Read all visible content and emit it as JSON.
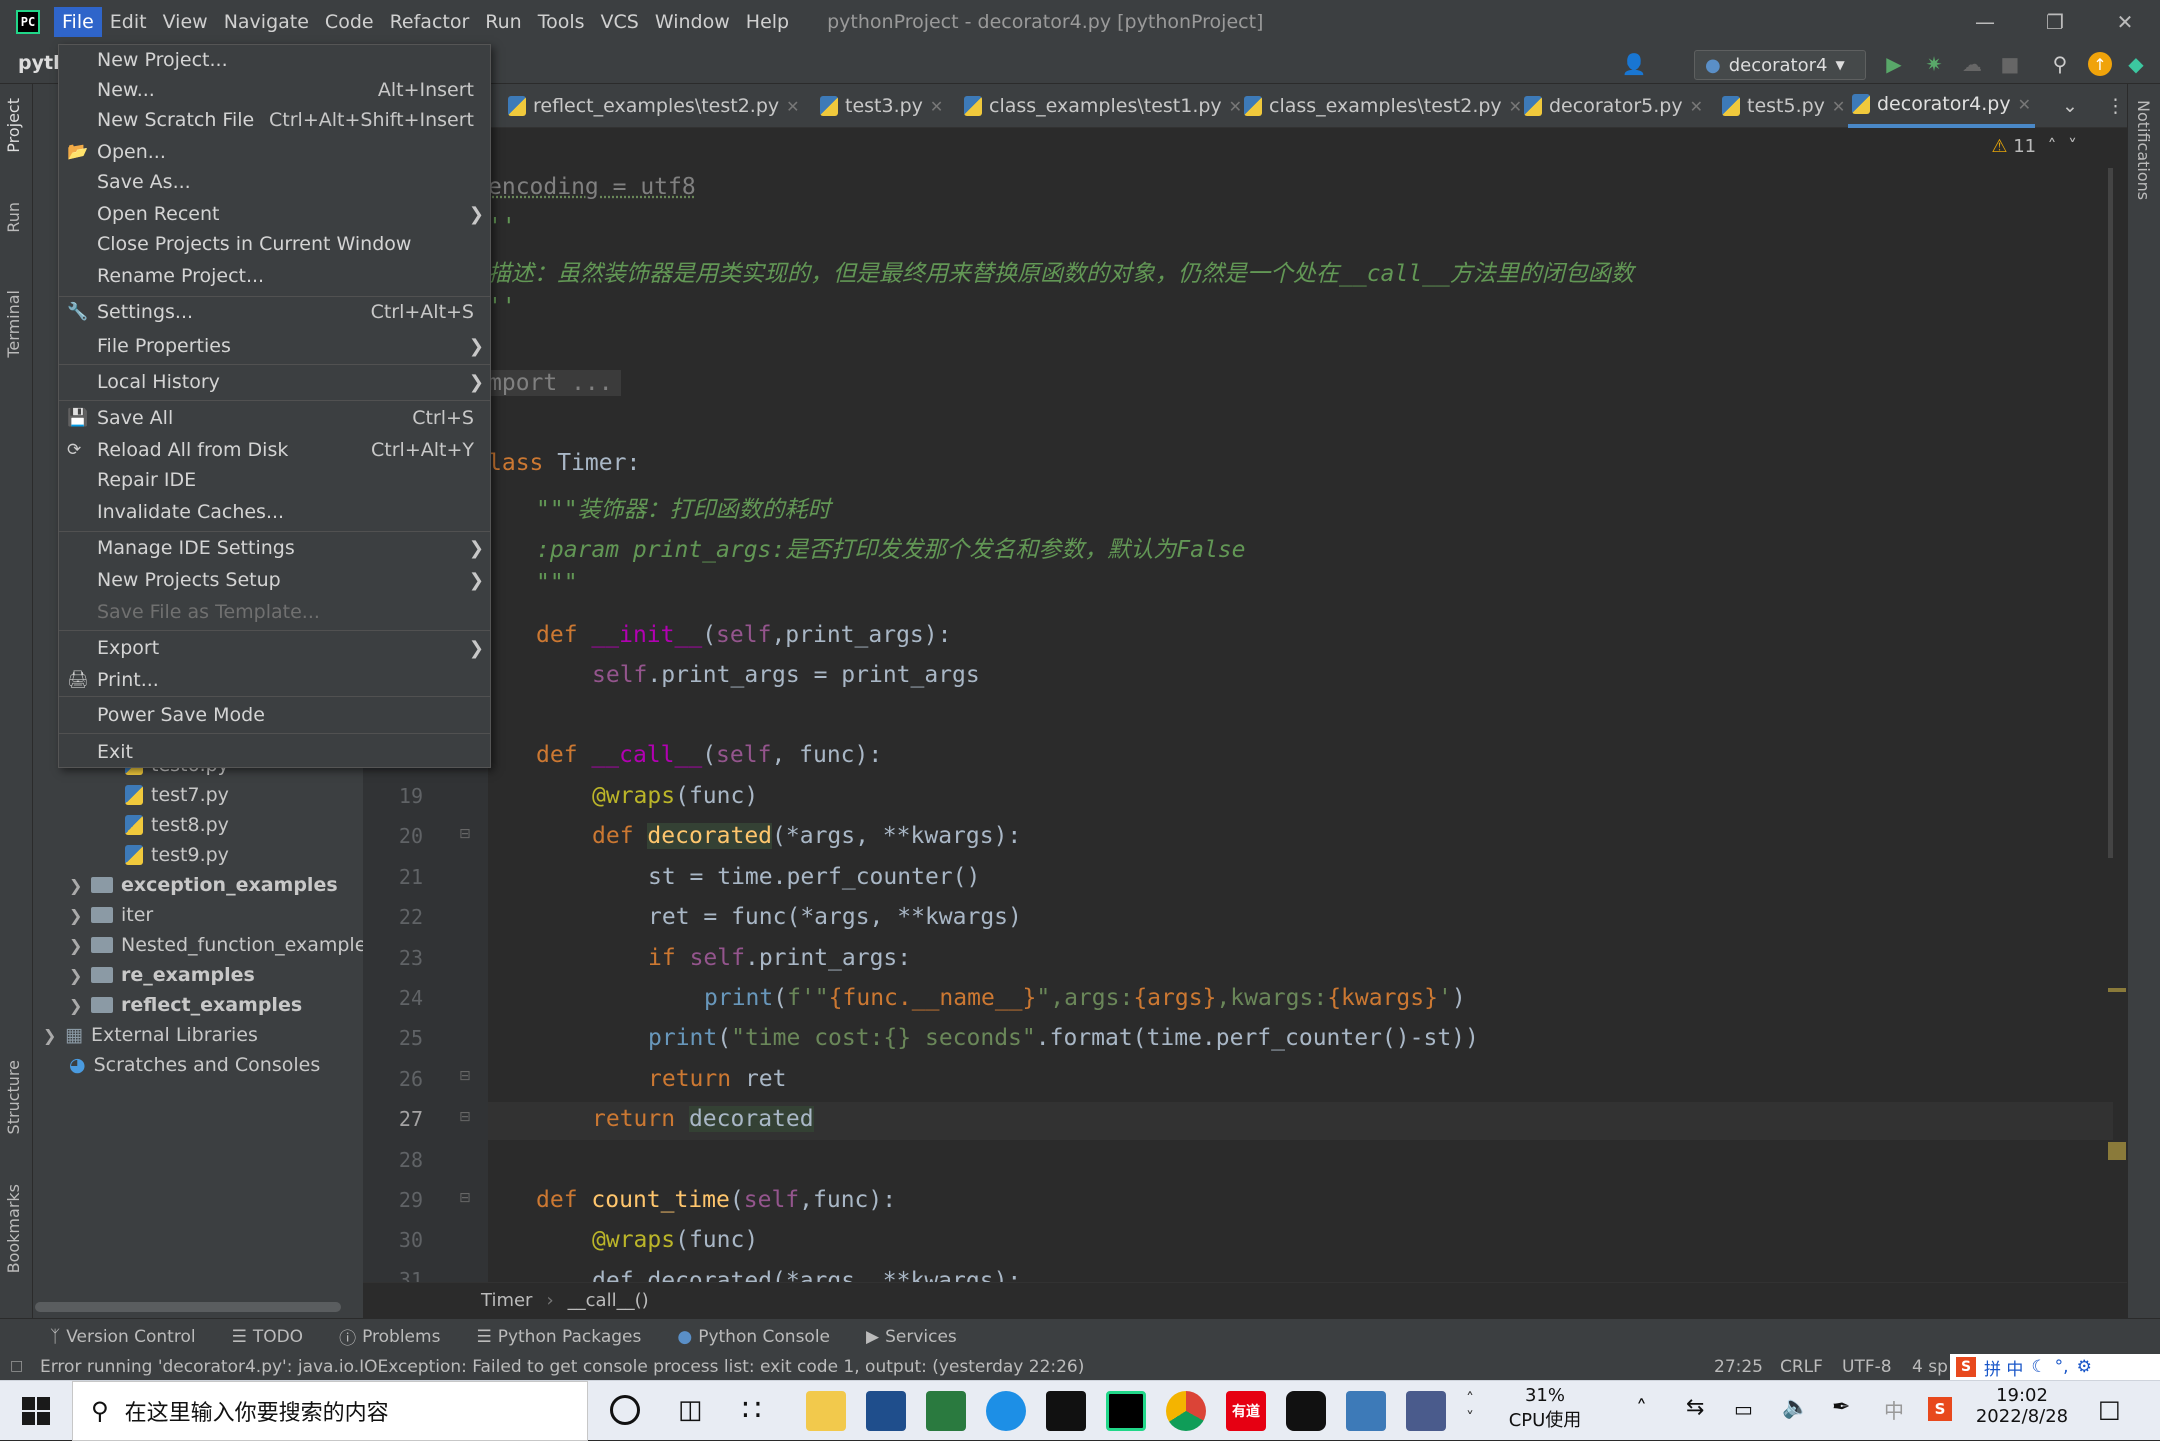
{
  "title_bar": {
    "menus": [
      "File",
      "Edit",
      "View",
      "Navigate",
      "Code",
      "Refactor",
      "Run",
      "Tools",
      "VCS",
      "Window",
      "Help"
    ],
    "window_title": "pythonProject - decorator4.py [pythonProject]"
  },
  "toolbar": {
    "project_crumb": "pyth",
    "run_config": "decorator4"
  },
  "tabs": [
    {
      "label": "reflect_examples\\test2.py"
    },
    {
      "label": "test3.py"
    },
    {
      "label": "class_examples\\test1.py"
    },
    {
      "label": "class_examples\\test2.py"
    },
    {
      "label": "decorator5.py"
    },
    {
      "label": "test5.py"
    },
    {
      "label": "decorator4.py"
    }
  ],
  "warnings_count": "11",
  "file_menu": {
    "items": [
      {
        "label": "New Project...",
        "shortcut": ""
      },
      {
        "label": "New...",
        "shortcut": "Alt+Insert"
      },
      {
        "label": "New Scratch File",
        "shortcut": "Ctrl+Alt+Shift+Insert"
      },
      {
        "label": "Open...",
        "shortcut": ""
      },
      {
        "label": "Save As...",
        "shortcut": ""
      },
      {
        "label": "Open Recent",
        "shortcut": ""
      },
      {
        "label": "Close Projects in Current Window",
        "shortcut": ""
      },
      {
        "label": "Rename Project...",
        "shortcut": ""
      },
      {
        "label": "Settings...",
        "shortcut": "Ctrl+Alt+S"
      },
      {
        "label": "File Properties",
        "shortcut": ""
      },
      {
        "label": "Local History",
        "shortcut": ""
      },
      {
        "label": "Save All",
        "shortcut": "Ctrl+S"
      },
      {
        "label": "Reload All from Disk",
        "shortcut": "Ctrl+Alt+Y"
      },
      {
        "label": "Repair IDE",
        "shortcut": ""
      },
      {
        "label": "Invalidate Caches...",
        "shortcut": ""
      },
      {
        "label": "Manage IDE Settings",
        "shortcut": ""
      },
      {
        "label": "New Projects Setup",
        "shortcut": ""
      },
      {
        "label": "Save File as Template...",
        "shortcut": ""
      },
      {
        "label": "Export",
        "shortcut": ""
      },
      {
        "label": "Print...",
        "shortcut": ""
      },
      {
        "label": "Power Save Mode",
        "shortcut": ""
      },
      {
        "label": "Exit",
        "shortcut": ""
      }
    ]
  },
  "project_tree": {
    "items": [
      "test6.py",
      "test7.py",
      "test8.py",
      "test9.py",
      "exception_examples",
      "iter",
      "Nested_function_examples",
      "re_examples",
      "reflect_examples",
      "External Libraries",
      "Scratches and Consoles"
    ]
  },
  "left_strip": {
    "project": "Project",
    "run": "Run",
    "terminal": "Terminal",
    "structure": "Structure",
    "bookmarks": "Bookmarks"
  },
  "right_strip": {
    "notifications": "Notifications"
  },
  "gutter_lines": [
    "19",
    "20",
    "21",
    "22",
    "23",
    "24",
    "25",
    "26",
    "27",
    "28",
    "29",
    "30",
    "31"
  ],
  "code": {
    "l1": "encoding = utf8",
    "l2": "''",
    "l3_text": "描述：虽然装饰器是用类实现的，但是最终用来替换原函数的对象，仍然是一个处在",
    "l3_call": "__call__",
    "l3_text2": "方法里的闭包函数",
    "l4": "''",
    "l5": "mport ...",
    "class_kw": "lass",
    "class_name": " Timer:",
    "doc1": "\"\"\"装饰器：打印函数的耗时",
    "doc2": ":param print_args:是否打印发发那个发名和参数，默认为False",
    "doc3": "\"\"\"",
    "def": "def",
    "init_fn": "__init__",
    "self": "self",
    "print_args": "print_args",
    "call_fn": "__call__",
    "wraps": "@wraps",
    "decorated": "decorated",
    "st_line": "st = time.perf_counter()",
    "ret_line": "ret = func(*args, **kwargs)",
    "if_kw": "if",
    "print_fn": "print",
    "fstr_a": "f'\"",
    "func_name": "{func.__name__}",
    "fstr_b": "\",args:",
    "args_b": "{args}",
    "fstr_c": ",kwargs:",
    "kwargs_b": "{kwargs}",
    "fstr_d": "'",
    "time_str": "\"time cost:{} seconds\"",
    "time_tail": ".format(time.perf_counter()-st))",
    "return_kw": "return",
    "ret": "ret",
    "count_time": "count_time",
    "func": "func",
    "last": "def decorated(*args, **kwargs):"
  },
  "breadcrumb": {
    "a": "Timer",
    "b": "__call__()"
  },
  "bottom_tabs": [
    "Version Control",
    "TODO",
    "Problems",
    "Python Packages",
    "Python Console",
    "Services"
  ],
  "status": {
    "message": "Error running 'decorator4.py': java.io.IOException: Failed to get console process list: exit code 1, output:  (yesterday 22:26)",
    "position": "27:25",
    "line_sep": "CRLF",
    "encoding": "UTF-8",
    "indent": "4 sp",
    "ime": "拼 中"
  },
  "taskbar": {
    "search_placeholder": "在这里输入你要搜索的内容",
    "cpu_pct": "31%",
    "cpu_label": "CPU使用",
    "ime_char": "中",
    "time": "19:02",
    "date": "2022/8/28",
    "youdao": "有道"
  }
}
